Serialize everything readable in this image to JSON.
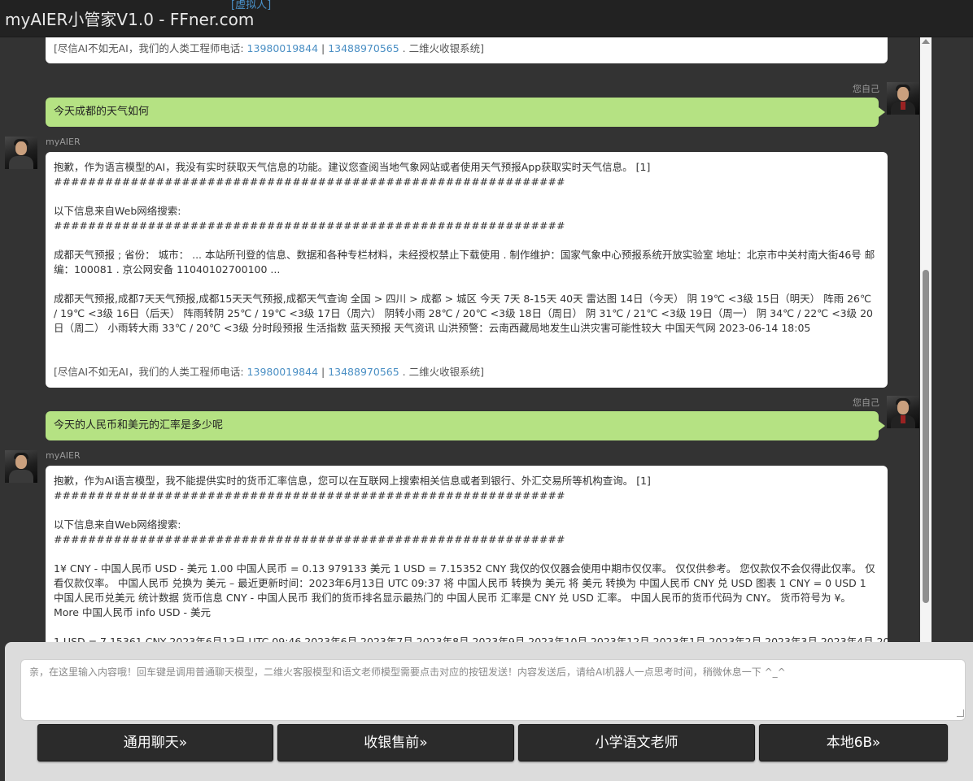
{
  "app": {
    "title": "myAIER小管家V1.0 - FFner.com",
    "virtual_link": "[虚拟人]"
  },
  "footer_note": {
    "prefix": "[尽信AI不如无AI，我们的人类工程师电话: ",
    "phone1": "13980019844",
    "sep": " | ",
    "phone2": "13488970565",
    "suffix": " . 二维火收银系统]"
  },
  "messages": {
    "user1": {
      "sender": "您自己",
      "text": "今天成都的天气如何"
    },
    "ai1": {
      "sender": "myAIER",
      "answer": "抱歉，作为语言模型的AI，我没有实时获取天气信息的功能。建议您查阅当地气象网站或者使用天气预报App获取实时天气信息。 [1]",
      "hash": "############################################################",
      "web_heading": "以下信息来自Web网络搜索:",
      "result1": "成都天气预报 ; 省份： 城市： ... 本站所刊登的信息、数据和各种专栏材料，未经授权禁止下载使用 . 制作维护：国家气象中心预报系统开放实验室 地址：北京市中关村南大街46号 邮编：100081 . 京公网安备 11040102700100 ...",
      "result2": "成都天气预报,成都7天天气预报,成都15天天气预报,成都天气查询 全国 > 四川 > 成都 > 城区 今天 7天 8-15天 40天 雷达图 14日（今天） 阴 19℃ <3级 15日（明天） 阵雨 26℃ / 19℃ <3级 16日（后天） 阵雨转阴 25℃ / 19℃ <3级 17日（周六） 阴转小雨 28℃ / 20℃ <3级 18日（周日） 阴 31℃ / 21℃ <3级 19日（周一） 阴 34℃ / 22℃ <3级 20日（周二） 小雨转大雨 33℃ / 20℃ <3级 分时段预报 生活指数 蓝天预报 天气资讯 山洪预警：云南西藏局地发生山洪灾害可能性较大 中国天气网 2023-06-14 18:05"
    },
    "user2": {
      "sender": "您自己",
      "text": "今天的人民币和美元的汇率是多少呢"
    },
    "ai2": {
      "sender": "myAIER",
      "answer": "抱歉，作为AI语言模型，我不能提供实时的货币汇率信息，您可以在互联网上搜索相关信息或者到银行、外汇交易所等机构查询。 [1]",
      "hash": "############################################################",
      "web_heading": "以下信息来自Web网络搜索:",
      "result1": "1¥ CNY - 中国人民币 USD - 美元 1.00 中国人民币 = 0.13 979133 美元 1 USD = 7.15352 CNY 我仅的仅仅器会使用中期市仅仅率。 仅仅供参考。 您仅款仅不会仅得此仅率。 仅看仅款仅率。 中国人民币 兑换为 美元 – 最近更新时间：2023年6月13日 UTC 09:37 将 中国人民币 转换为 美元 将 美元 转换为 中国人民币 CNY 兑 USD 图表 1 CNY = 0 USD 1 中国人民币兑美元 统计数据 货币信息 CNY - 中国人民币 我们的货币排名显示最热门的 中国人民币 汇率是 CNY 兑 USD 汇率。 中国人民币的货币代码为 CNY。 货币符号为 ¥。 More 中国人民币 info USD - 美元",
      "result2_partial": "1 USD = 7.15361 CNY 2023年6月13日 UTC 09:46 2023年6月 2023年7月 2023年8月 2023年9月 2023年10月 2023年12月 2023年1月 2023年2月 2023年3月 2023年4月 2023年6月"
    }
  },
  "input": {
    "placeholder": "亲，在这里输入内容哦！回车键是调用普通聊天模型，二维火客服模型和语文老师模型需要点击对应的按钮发送！内容发送后，请给AI机器人一点思考时间，稍微休息一下 ^_^"
  },
  "buttons": {
    "general_chat": "通用聊天»",
    "cashier_presales": "收银售前»",
    "chinese_teacher": "小学语文老师",
    "local_6b": "本地6B»"
  },
  "icons": {
    "user_avatar": "avatar-icon",
    "ai_avatar": "avatar-icon",
    "scroll_up": "triangle-up-icon"
  },
  "colors": {
    "user_bubble": "#b5e283",
    "ai_bubble": "#ffffff",
    "background": "#333333",
    "link": "#4a8fc4"
  }
}
